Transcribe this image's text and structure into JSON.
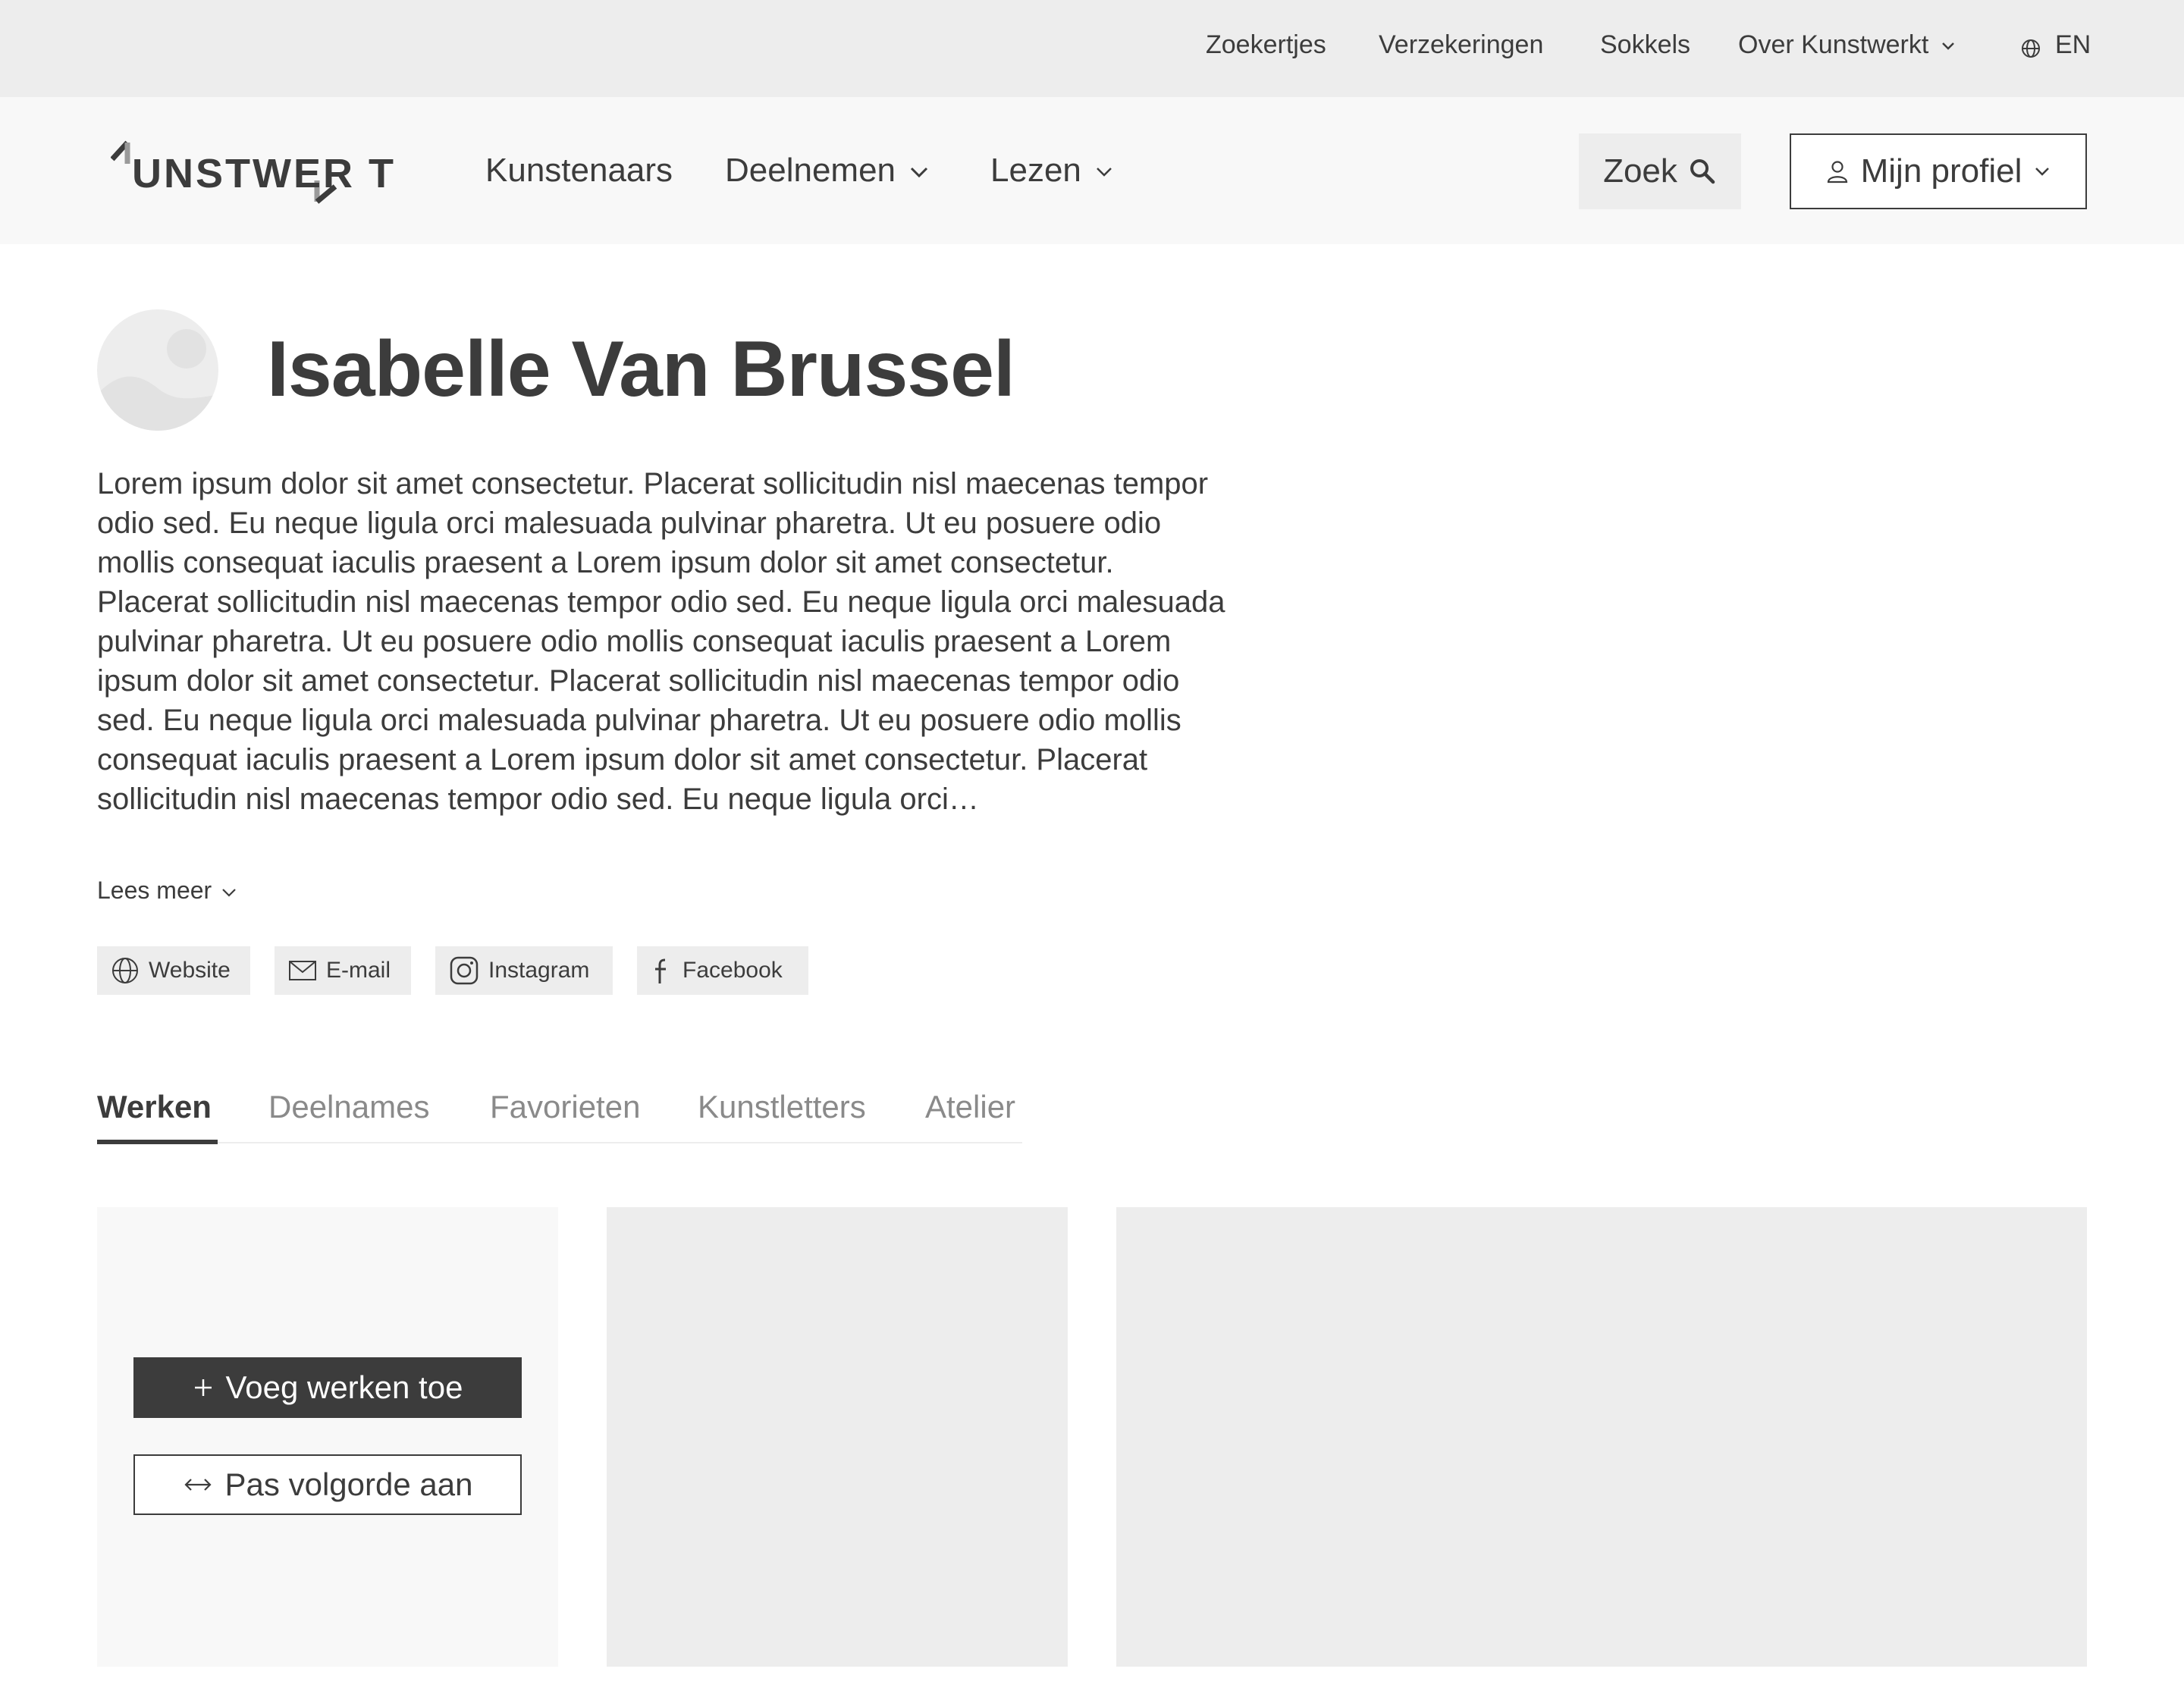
{
  "topbar": {
    "links": [
      "Zoekertjes",
      "Verzekeringen",
      "Sokkels",
      "Over Kunstwerkt"
    ],
    "language": "EN"
  },
  "header": {
    "logo_text": "UNSTWER T",
    "nav": [
      "Kunstenaars",
      "Deelnemen",
      "Lezen"
    ],
    "search_label": "Zoek",
    "profile_label": "Mijn profiel"
  },
  "profile": {
    "name": "Isabelle Van Brussel",
    "bio": "Lorem ipsum dolor sit amet consectetur. Placerat sollicitudin nisl maecenas tempor odio sed. Eu neque ligula orci malesuada pulvinar pharetra. Ut eu posuere odio mollis consequat iaculis praesent a Lorem ipsum dolor sit amet consectetur. Placerat sollicitudin nisl maecenas tempor odio sed. Eu neque ligula orci malesuada pulvinar pharetra. Ut eu posuere odio mollis consequat iaculis praesent a Lorem ipsum dolor sit amet consectetur. Placerat sollicitudin nisl maecenas tempor odio sed. Eu neque ligula orci malesuada pulvinar pharetra. Ut eu posuere odio mollis consequat iaculis praesent a Lorem ipsum dolor sit amet consectetur. Placerat sollicitudin nisl maecenas tempor odio sed. Eu neque ligula orci…",
    "read_more": "Lees meer",
    "social": [
      {
        "label": "Website",
        "icon": "globe-icon"
      },
      {
        "label": "E-mail",
        "icon": "mail-icon"
      },
      {
        "label": "Instagram",
        "icon": "instagram-icon"
      },
      {
        "label": "Facebook",
        "icon": "facebook-icon"
      }
    ]
  },
  "tabs": [
    "Werken",
    "Deelnames",
    "Favorieten",
    "Kunstletters",
    "Atelier"
  ],
  "works": {
    "add_label": "Voeg werken toe",
    "order_label": "Pas volgorde aan"
  },
  "colors": {
    "text": "#3c3c3c",
    "muted": "#8a8a8a",
    "topbar_bg": "#ededed",
    "header_bg": "#f8f8f8",
    "placeholder": "#ededed"
  }
}
